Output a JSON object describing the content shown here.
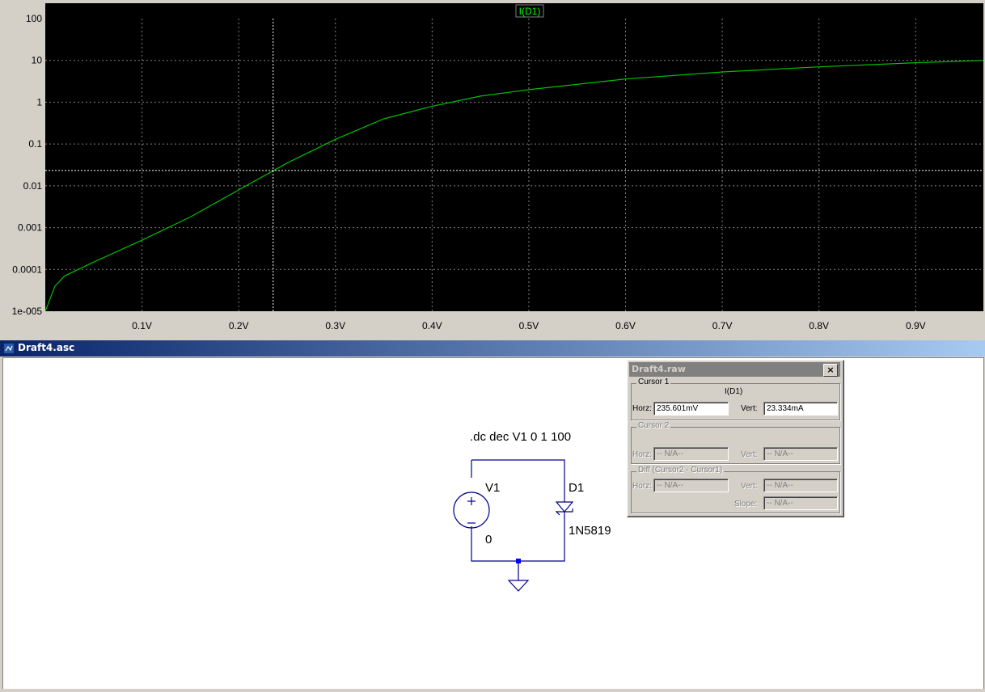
{
  "plot": {
    "trace_label": "I(D1)",
    "y_ticks": [
      "100",
      "10",
      "1",
      "0.1",
      "0.01",
      "0.001",
      "0.0001",
      "1e-005"
    ],
    "x_ticks": [
      "0.1V",
      "0.2V",
      "0.3V",
      "0.4V",
      "0.5V",
      "0.6V",
      "0.7V",
      "0.8V",
      "0.9V"
    ],
    "colors": {
      "background": "#000000",
      "grid": "#808080",
      "trace": "#00c000",
      "label": "#00ff00",
      "cursor": "#ffffff"
    }
  },
  "chart_data": {
    "type": "line",
    "title": "I(D1)",
    "xlabel": "",
    "ylabel": "",
    "y_scale": "log",
    "xlim": [
      0.0,
      0.97
    ],
    "ylim": [
      1e-05,
      100
    ],
    "series": [
      {
        "name": "I(D1)",
        "x": [
          0.0,
          0.01,
          0.02,
          0.05,
          0.1,
          0.15,
          0.2,
          0.25,
          0.3,
          0.35,
          0.4,
          0.45,
          0.5,
          0.6,
          0.7,
          0.8,
          0.9,
          0.97
        ],
        "y": [
          1e-05,
          4e-05,
          7e-05,
          0.00015,
          0.0005,
          0.0018,
          0.008,
          0.035,
          0.13,
          0.4,
          0.8,
          1.4,
          2.0,
          3.6,
          5.3,
          7.0,
          8.8,
          10.0
        ]
      }
    ],
    "cursor": {
      "x": 0.235601,
      "y": 0.023334
    },
    "grid": true
  },
  "schematic": {
    "window_title": "Draft4.asc",
    "directive": ".dc dec V1 0 1 100",
    "source_label": "V1",
    "source_value": "0",
    "diode_label": "D1",
    "diode_model": "1N5819"
  },
  "cursor_dialog": {
    "title": "Draft4.raw",
    "close_label": "×",
    "cursor1": {
      "group": "Cursor 1",
      "trace": "I(D1)",
      "horz_label": "Horz:",
      "horz_value": "235.601mV",
      "vert_label": "Vert:",
      "vert_value": "23.334mA"
    },
    "cursor2": {
      "group": "Cursor 2",
      "horz_label": "Horz:",
      "horz_value": "-- N/A--",
      "vert_label": "Vert:",
      "vert_value": "-- N/A--"
    },
    "diff": {
      "group": "Diff (Cursor2 - Cursor1)",
      "horz_label": "Horz:",
      "horz_value": "-- N/A--",
      "vert_label": "Vert:",
      "vert_value": "-- N/A--",
      "slope_label": "Slope:",
      "slope_value": "-- N/A--"
    }
  }
}
